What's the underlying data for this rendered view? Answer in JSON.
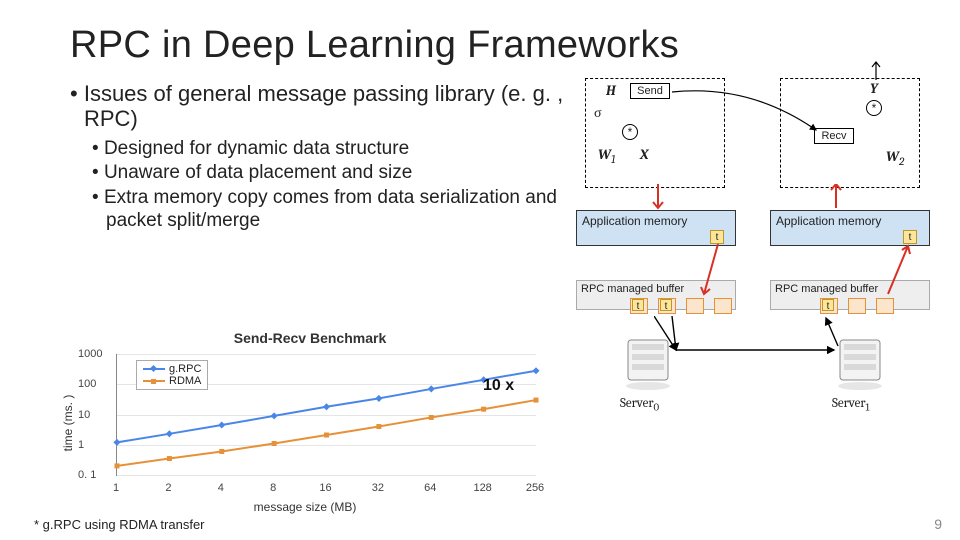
{
  "title": "RPC in Deep Learning Frameworks",
  "bullets": {
    "main": "Issues of general message passing library (e. g. , RPC)",
    "subs": [
      "Designed for dynamic data structure",
      "Unaware of data placement and size",
      "Extra memory copy comes from data serialization and packet split/merge"
    ]
  },
  "chart_data": {
    "type": "line",
    "title": "Send-Recv Benchmark",
    "xlabel": "message size (MB)",
    "ylabel": "time (ms. )",
    "x": [
      1,
      2,
      4,
      8,
      16,
      32,
      64,
      128,
      256
    ],
    "y_log": true,
    "ylim": [
      0.1,
      1000
    ],
    "yticks": [
      0.1,
      1,
      10,
      100,
      1000
    ],
    "yticks_labels": [
      "0. 1",
      "1",
      "10",
      "100",
      "1000"
    ],
    "series": [
      {
        "name": "g.RPC",
        "color": "#4a86e8",
        "marker": "diamond",
        "values": [
          1.2,
          2.3,
          4.5,
          9,
          18,
          34,
          70,
          140,
          280
        ]
      },
      {
        "name": "RDMA",
        "color": "#e69138",
        "marker": "square",
        "values": [
          0.2,
          0.35,
          0.6,
          1.1,
          2.1,
          4,
          8,
          15,
          30
        ]
      }
    ],
    "annotation": {
      "label": "10 x",
      "x": 256,
      "between_series": true
    }
  },
  "diagram": {
    "send_label": "Send",
    "recv_label": "Recv",
    "sigma": "σ",
    "star": "*",
    "H": "H",
    "Y": "Y",
    "W1": "W",
    "W1_sub": "1",
    "W2": "W",
    "W2_sub": "2",
    "X": "X",
    "appmem": "Application memory",
    "rpcbuf": "RPC managed buffer",
    "t": "t",
    "server0": "Server",
    "server0_sub": "0",
    "server1": "Server",
    "server1_sub": "1"
  },
  "footnote": "* g.RPC using RDMA transfer",
  "slide_number": "9"
}
